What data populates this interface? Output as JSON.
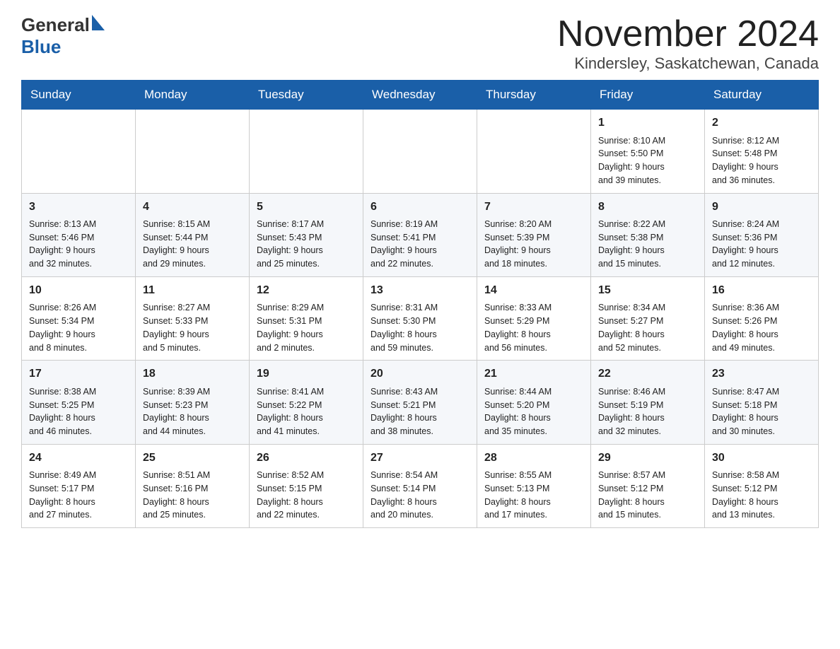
{
  "header": {
    "logo_general": "General",
    "logo_blue": "Blue",
    "month_title": "November 2024",
    "location": "Kindersley, Saskatchewan, Canada"
  },
  "weekdays": [
    "Sunday",
    "Monday",
    "Tuesday",
    "Wednesday",
    "Thursday",
    "Friday",
    "Saturday"
  ],
  "weeks": [
    [
      {
        "day": "",
        "info": ""
      },
      {
        "day": "",
        "info": ""
      },
      {
        "day": "",
        "info": ""
      },
      {
        "day": "",
        "info": ""
      },
      {
        "day": "",
        "info": ""
      },
      {
        "day": "1",
        "info": "Sunrise: 8:10 AM\nSunset: 5:50 PM\nDaylight: 9 hours\nand 39 minutes."
      },
      {
        "day": "2",
        "info": "Sunrise: 8:12 AM\nSunset: 5:48 PM\nDaylight: 9 hours\nand 36 minutes."
      }
    ],
    [
      {
        "day": "3",
        "info": "Sunrise: 8:13 AM\nSunset: 5:46 PM\nDaylight: 9 hours\nand 32 minutes."
      },
      {
        "day": "4",
        "info": "Sunrise: 8:15 AM\nSunset: 5:44 PM\nDaylight: 9 hours\nand 29 minutes."
      },
      {
        "day": "5",
        "info": "Sunrise: 8:17 AM\nSunset: 5:43 PM\nDaylight: 9 hours\nand 25 minutes."
      },
      {
        "day": "6",
        "info": "Sunrise: 8:19 AM\nSunset: 5:41 PM\nDaylight: 9 hours\nand 22 minutes."
      },
      {
        "day": "7",
        "info": "Sunrise: 8:20 AM\nSunset: 5:39 PM\nDaylight: 9 hours\nand 18 minutes."
      },
      {
        "day": "8",
        "info": "Sunrise: 8:22 AM\nSunset: 5:38 PM\nDaylight: 9 hours\nand 15 minutes."
      },
      {
        "day": "9",
        "info": "Sunrise: 8:24 AM\nSunset: 5:36 PM\nDaylight: 9 hours\nand 12 minutes."
      }
    ],
    [
      {
        "day": "10",
        "info": "Sunrise: 8:26 AM\nSunset: 5:34 PM\nDaylight: 9 hours\nand 8 minutes."
      },
      {
        "day": "11",
        "info": "Sunrise: 8:27 AM\nSunset: 5:33 PM\nDaylight: 9 hours\nand 5 minutes."
      },
      {
        "day": "12",
        "info": "Sunrise: 8:29 AM\nSunset: 5:31 PM\nDaylight: 9 hours\nand 2 minutes."
      },
      {
        "day": "13",
        "info": "Sunrise: 8:31 AM\nSunset: 5:30 PM\nDaylight: 8 hours\nand 59 minutes."
      },
      {
        "day": "14",
        "info": "Sunrise: 8:33 AM\nSunset: 5:29 PM\nDaylight: 8 hours\nand 56 minutes."
      },
      {
        "day": "15",
        "info": "Sunrise: 8:34 AM\nSunset: 5:27 PM\nDaylight: 8 hours\nand 52 minutes."
      },
      {
        "day": "16",
        "info": "Sunrise: 8:36 AM\nSunset: 5:26 PM\nDaylight: 8 hours\nand 49 minutes."
      }
    ],
    [
      {
        "day": "17",
        "info": "Sunrise: 8:38 AM\nSunset: 5:25 PM\nDaylight: 8 hours\nand 46 minutes."
      },
      {
        "day": "18",
        "info": "Sunrise: 8:39 AM\nSunset: 5:23 PM\nDaylight: 8 hours\nand 44 minutes."
      },
      {
        "day": "19",
        "info": "Sunrise: 8:41 AM\nSunset: 5:22 PM\nDaylight: 8 hours\nand 41 minutes."
      },
      {
        "day": "20",
        "info": "Sunrise: 8:43 AM\nSunset: 5:21 PM\nDaylight: 8 hours\nand 38 minutes."
      },
      {
        "day": "21",
        "info": "Sunrise: 8:44 AM\nSunset: 5:20 PM\nDaylight: 8 hours\nand 35 minutes."
      },
      {
        "day": "22",
        "info": "Sunrise: 8:46 AM\nSunset: 5:19 PM\nDaylight: 8 hours\nand 32 minutes."
      },
      {
        "day": "23",
        "info": "Sunrise: 8:47 AM\nSunset: 5:18 PM\nDaylight: 8 hours\nand 30 minutes."
      }
    ],
    [
      {
        "day": "24",
        "info": "Sunrise: 8:49 AM\nSunset: 5:17 PM\nDaylight: 8 hours\nand 27 minutes."
      },
      {
        "day": "25",
        "info": "Sunrise: 8:51 AM\nSunset: 5:16 PM\nDaylight: 8 hours\nand 25 minutes."
      },
      {
        "day": "26",
        "info": "Sunrise: 8:52 AM\nSunset: 5:15 PM\nDaylight: 8 hours\nand 22 minutes."
      },
      {
        "day": "27",
        "info": "Sunrise: 8:54 AM\nSunset: 5:14 PM\nDaylight: 8 hours\nand 20 minutes."
      },
      {
        "day": "28",
        "info": "Sunrise: 8:55 AM\nSunset: 5:13 PM\nDaylight: 8 hours\nand 17 minutes."
      },
      {
        "day": "29",
        "info": "Sunrise: 8:57 AM\nSunset: 5:12 PM\nDaylight: 8 hours\nand 15 minutes."
      },
      {
        "day": "30",
        "info": "Sunrise: 8:58 AM\nSunset: 5:12 PM\nDaylight: 8 hours\nand 13 minutes."
      }
    ]
  ]
}
